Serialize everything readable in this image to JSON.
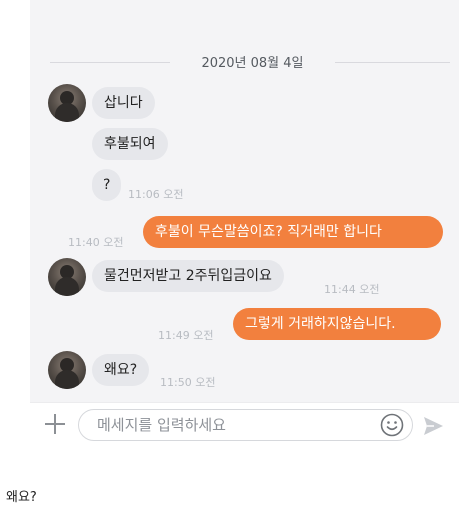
{
  "chat": {
    "date": "2020년 08월 4일",
    "messages": [
      {
        "text": "삽니다"
      },
      {
        "text": "후불되여"
      },
      {
        "text": "?",
        "time": "11:06 오전"
      },
      {
        "text": "후불이 무슨말씀이죠? 직거래만 합니다",
        "time": "11:40 오전"
      },
      {
        "text": "물건먼저받고 2주뒤입금이요",
        "time": "11:44 오전"
      },
      {
        "text": "그렇게 거래하지않습니다.",
        "time": "11:49 오전"
      },
      {
        "text": "왜요?",
        "time": "11:50 오전"
      }
    ]
  },
  "composer": {
    "placeholder": "메세지를 입력하세요",
    "icons": {
      "add": "plus-icon",
      "emoji": "smiley-icon",
      "send": "send-icon"
    }
  },
  "caption": "왜요?",
  "colors": {
    "outgoing": "#f2803e",
    "incoming": "#e6e7eb",
    "background": "#f4f4f6"
  }
}
